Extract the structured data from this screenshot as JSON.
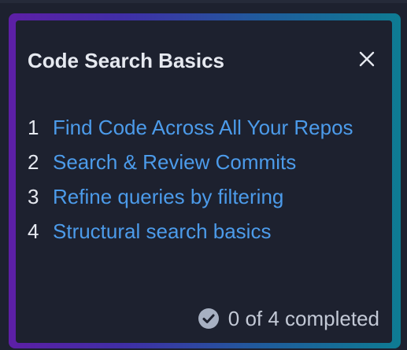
{
  "panel": {
    "title": "Code Search Basics",
    "close_icon": "close-icon"
  },
  "steps": [
    {
      "number": "1",
      "label": "Find Code Across All Your Repos"
    },
    {
      "number": "2",
      "label": "Search & Review Commits"
    },
    {
      "number": "3",
      "label": "Refine queries by filtering"
    },
    {
      "number": "4",
      "label": "Structural search basics"
    }
  ],
  "footer": {
    "status": "0 of 4 completed",
    "status_icon": "check-circle-icon"
  },
  "colors": {
    "background": "#1d212f",
    "link": "#4c9bea",
    "text": "#e6e9f0",
    "muted": "#c3c9d6",
    "gradient_start": "#5d1fa6",
    "gradient_end": "#0e7c93"
  }
}
